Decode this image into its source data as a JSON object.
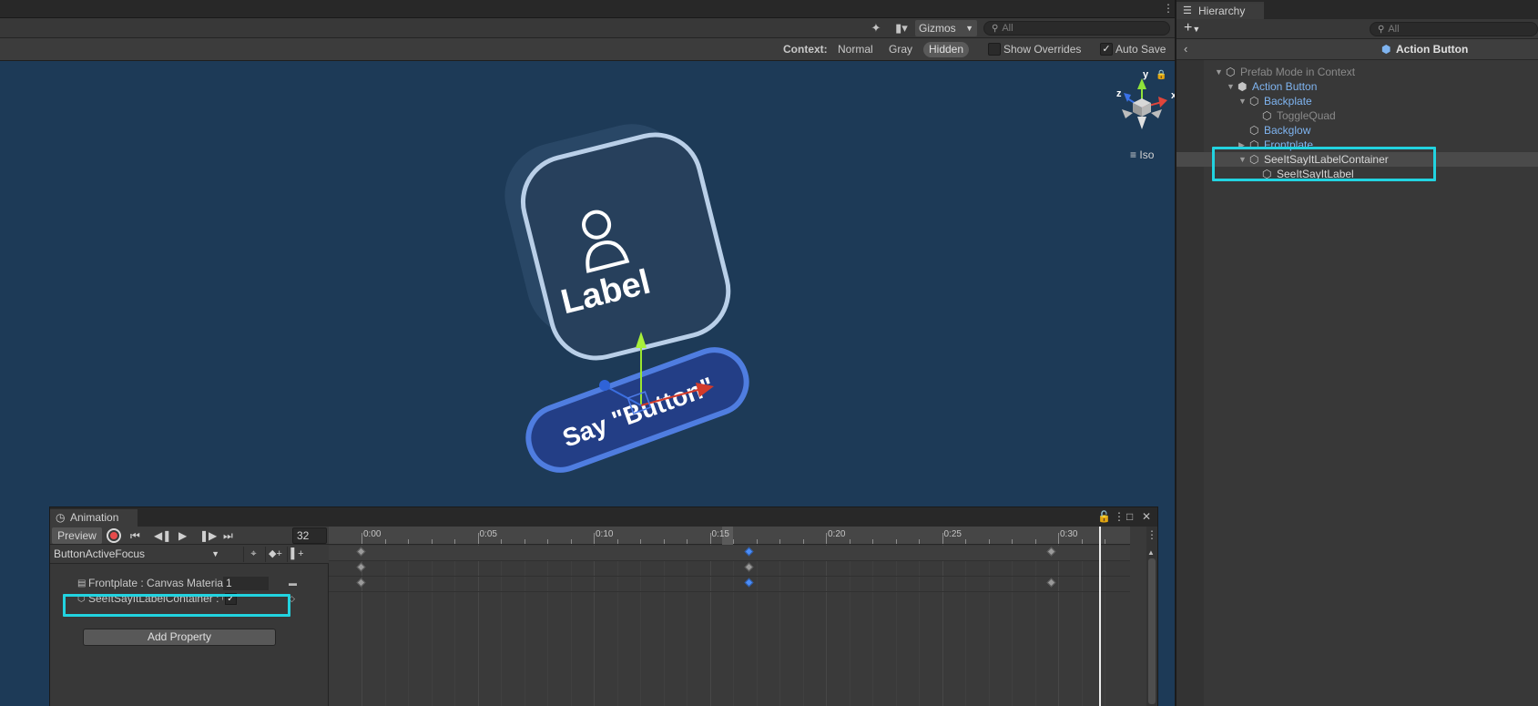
{
  "scene": {
    "toolbar": {
      "gizmos_label": "Gizmos",
      "search_placeholder": "All"
    },
    "context_bar": {
      "context_label": "Context:",
      "options": [
        "Normal",
        "Gray",
        "Hidden"
      ],
      "active_option": "Hidden",
      "show_overrides_label": "Show Overrides",
      "show_overrides_checked": false,
      "auto_save_label": "Auto Save",
      "auto_save_checked": true
    },
    "gizmo": {
      "x_label": "x",
      "y_label": "y",
      "z_label": "z",
      "projection_label": "Iso"
    },
    "button_model": {
      "label_text": "Label",
      "say_text": "Say \"Button\""
    }
  },
  "hierarchy": {
    "tab_label": "Hierarchy",
    "search_placeholder": "All",
    "header_title": "Action Button",
    "items": [
      {
        "label": "Prefab Mode in Context",
        "style": "grey"
      },
      {
        "label": "Action Button",
        "style": "blue"
      },
      {
        "label": "Backplate",
        "style": "blue"
      },
      {
        "label": "ToggleQuad",
        "style": "grey"
      },
      {
        "label": "Backglow",
        "style": "blue"
      },
      {
        "label": "Frontplate",
        "style": "blue"
      },
      {
        "label": "SeeItSayItLabelContainer",
        "style": "white"
      },
      {
        "label": "SeeItSayItLabel",
        "style": "white"
      }
    ]
  },
  "animation": {
    "tab_label": "Animation",
    "preview_label": "Preview",
    "frame_value": "32",
    "clip_name": "ButtonActiveFocus",
    "properties": [
      {
        "label": "Frontplate : Canvas Material",
        "value": "1"
      },
      {
        "label": "SeeItSayItLabelContainer : G",
        "checked": true
      }
    ],
    "add_property_label": "Add Property",
    "timeline_labels": [
      "0:00",
      "0:05",
      "0:10",
      "0:15",
      "0:20",
      "0:25",
      "0:30"
    ]
  },
  "colors": {
    "highlight": "#22d3e0",
    "scene_bg": "#1d3a57",
    "selected_key": "#4c8df6",
    "hierarchy_prefab_text": "#7fb4f0"
  }
}
